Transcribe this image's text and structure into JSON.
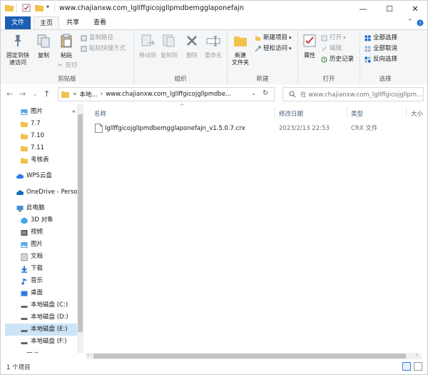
{
  "window": {
    "title": "www.chajianxw.com_lgllffgicojgllpmdbemgglaponefajn",
    "minimize": "—",
    "maximize": "☐",
    "close": "✕"
  },
  "tabs": [
    {
      "label": "文件"
    },
    {
      "label": "主页"
    },
    {
      "label": "共享"
    },
    {
      "label": "查看"
    }
  ],
  "ribbon": {
    "clipboard": {
      "label": "剪贴板",
      "pin": "固定到快\n速访问",
      "copy": "复制",
      "paste": "粘贴",
      "copy_path": "复制路径",
      "paste_shortcut": "粘贴快捷方式",
      "cut": "剪切"
    },
    "organize": {
      "label": "组织",
      "move_to": "移动到",
      "copy_to": "复制到",
      "delete": "删除",
      "rename": "重命名"
    },
    "new": {
      "label": "新建",
      "new_folder": "新建\n文件夹",
      "new_item": "新建项目",
      "easy_access": "轻松访问"
    },
    "open": {
      "label": "打开",
      "properties": "属性",
      "open": "打开",
      "edit": "编辑",
      "history": "历史记录"
    },
    "select": {
      "label": "选择",
      "select_all": "全部选择",
      "select_none": "全部取消",
      "invert": "反向选择"
    }
  },
  "address": {
    "path_prefix": "«",
    "crumb1": "本地...",
    "crumb2": "www.chajianxw.com_lgllffgicojgllpmdbe...",
    "search_placeholder": "在 www.chajianxw.com_lgllffgicojgllpm..."
  },
  "nav": {
    "quick": [
      {
        "label": "图片"
      },
      {
        "label": "7.7"
      },
      {
        "label": "7.10"
      },
      {
        "label": "7.11"
      },
      {
        "label": "考核表"
      }
    ],
    "wps": "WPS云盘",
    "onedrive": "OneDrive - Perso",
    "thispc": "此电脑",
    "pc_items": [
      {
        "label": "3D 对象"
      },
      {
        "label": "视频"
      },
      {
        "label": "图片"
      },
      {
        "label": "文档"
      },
      {
        "label": "下载"
      },
      {
        "label": "音乐"
      },
      {
        "label": "桌面"
      },
      {
        "label": "本地磁盘 (C:)"
      },
      {
        "label": "本地磁盘 (D:)"
      },
      {
        "label": "本地磁盘 (E:)"
      },
      {
        "label": "本地磁盘 (F:)"
      }
    ],
    "network": "网络"
  },
  "columns": {
    "name": "名称",
    "date": "修改日期",
    "type": "类型",
    "size": "大小"
  },
  "files": [
    {
      "name": "lgllffgicojgllpmdbemgglaponefajn_v1.5.0.7.crx",
      "date": "2023/2/13 22:53",
      "type": "CRX 文件"
    }
  ],
  "status": {
    "count": "1 个项目"
  },
  "colors": {
    "file_tab": "#1a5fb4",
    "selected": "#cce4f7",
    "folder": "#f2c14e"
  }
}
